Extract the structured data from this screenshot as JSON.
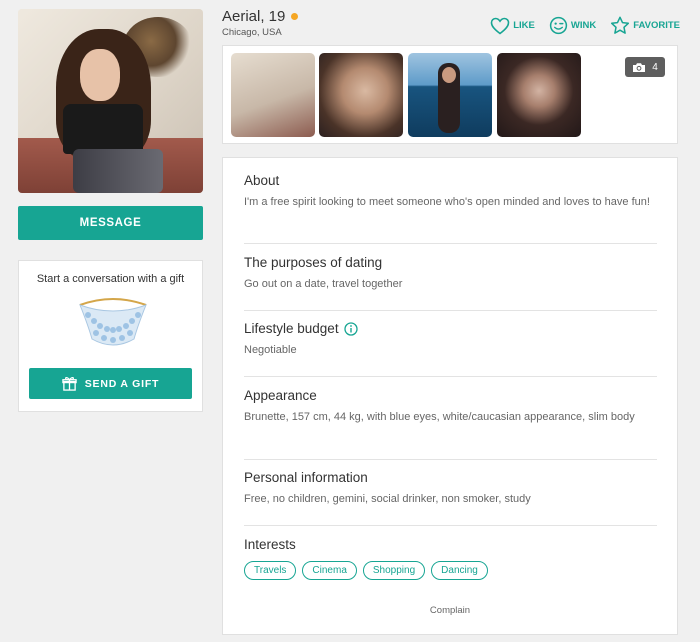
{
  "profile": {
    "name_age": "Aerial, 19",
    "location": "Chicago, USA",
    "status_color": "#f5a623"
  },
  "actions": {
    "like": "LIKE",
    "wink": "WINK",
    "favorite": "FAVORITE"
  },
  "photos": {
    "count": "4"
  },
  "left": {
    "message_label": "MESSAGE",
    "gift_caption": "Start a conversation with a gift",
    "send_gift_label": "SEND A GIFT"
  },
  "sections": {
    "about": {
      "title": "About",
      "text": "I'm a free spirit looking to meet someone who's open minded and loves to have fun!"
    },
    "purposes": {
      "title": "The purposes of dating",
      "text": "Go out on a date, travel together"
    },
    "budget": {
      "title": "Lifestyle budget",
      "text": "Negotiable"
    },
    "appearance": {
      "title": "Appearance",
      "text": "Brunette, 157 cm, 44 kg, with blue eyes, white/caucasian appearance, slim body"
    },
    "personal": {
      "title": "Personal information",
      "text": "Free, no children, gemini, social drinker, non smoker, study"
    },
    "interests": {
      "title": "Interests",
      "tags": [
        "Travels",
        "Cinema",
        "Shopping",
        "Dancing"
      ]
    }
  },
  "complain_label": "Complain",
  "colors": {
    "accent": "#17a593",
    "background": "#f0f0f0"
  }
}
